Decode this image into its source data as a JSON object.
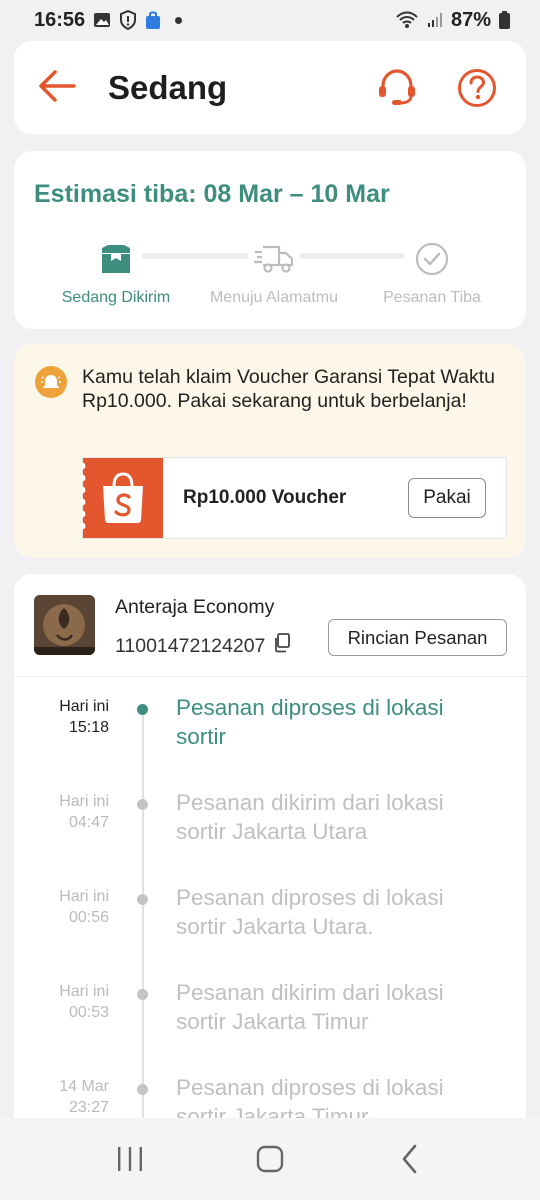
{
  "status_bar": {
    "time": "16:56",
    "battery": "87%",
    "icons": [
      "gallery-icon",
      "shield-alert-icon",
      "shopping-bag-icon",
      "notification-dot",
      "wifi-icon",
      "signal-icon",
      "battery-icon"
    ]
  },
  "header": {
    "title": "Sedang",
    "accent_color": "#e4572e"
  },
  "estimate": {
    "title": "Estimasi tiba: 08 Mar – 10 Mar",
    "accent_color": "#3d8e7f",
    "steps": [
      {
        "label": "Sedang Dikirim",
        "icon": "package-icon",
        "active": true
      },
      {
        "label": "Menuju Alamatmu",
        "icon": "delivery-truck-icon",
        "active": false
      },
      {
        "label": "Pesanan Tiba",
        "icon": "check-circle-icon",
        "active": false
      }
    ]
  },
  "voucher": {
    "message": "Kamu telah klaim Voucher Garansi Tepat Waktu Rp10.000. Pakai sekarang untuk berbelanja!",
    "ticket_label": "Rp10.000 Voucher",
    "button_label": "Pakai"
  },
  "shipment": {
    "courier": "Anteraja Economy",
    "tracking_number": "11001472124207",
    "detail_button": "Rincian Pesanan",
    "events": [
      {
        "day": "Hari ini",
        "time": "15:18",
        "text": "Pesanan diproses di lokasi sortir",
        "current": true
      },
      {
        "day": "Hari ini",
        "time": "04:47",
        "text": "Pesanan dikirim dari lokasi sortir  Jakarta Utara",
        "current": false
      },
      {
        "day": "Hari ini",
        "time": "00:56",
        "text": "Pesanan diproses di lokasi sortir  Jakarta Utara.",
        "current": false
      },
      {
        "day": "Hari ini",
        "time": "00:53",
        "text": "Pesanan dikirim dari lokasi sortir  Jakarta Timur",
        "current": false
      },
      {
        "day": "14 Mar",
        "time": "23:27",
        "text": "Pesanan diproses di lokasi sortir  Jakarta Timur",
        "current": false
      }
    ]
  }
}
